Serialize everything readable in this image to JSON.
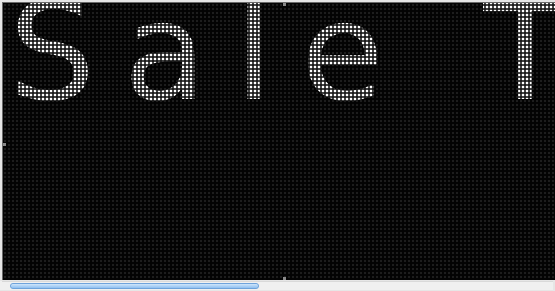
{
  "sign": {
    "message": "Sale Tod",
    "led_color": "#ffffff",
    "panel_color": "#030303"
  },
  "scrollbar": {
    "position_fraction": 0.0,
    "visible_fraction": 0.46,
    "thumb_color": "#8fbff0"
  }
}
